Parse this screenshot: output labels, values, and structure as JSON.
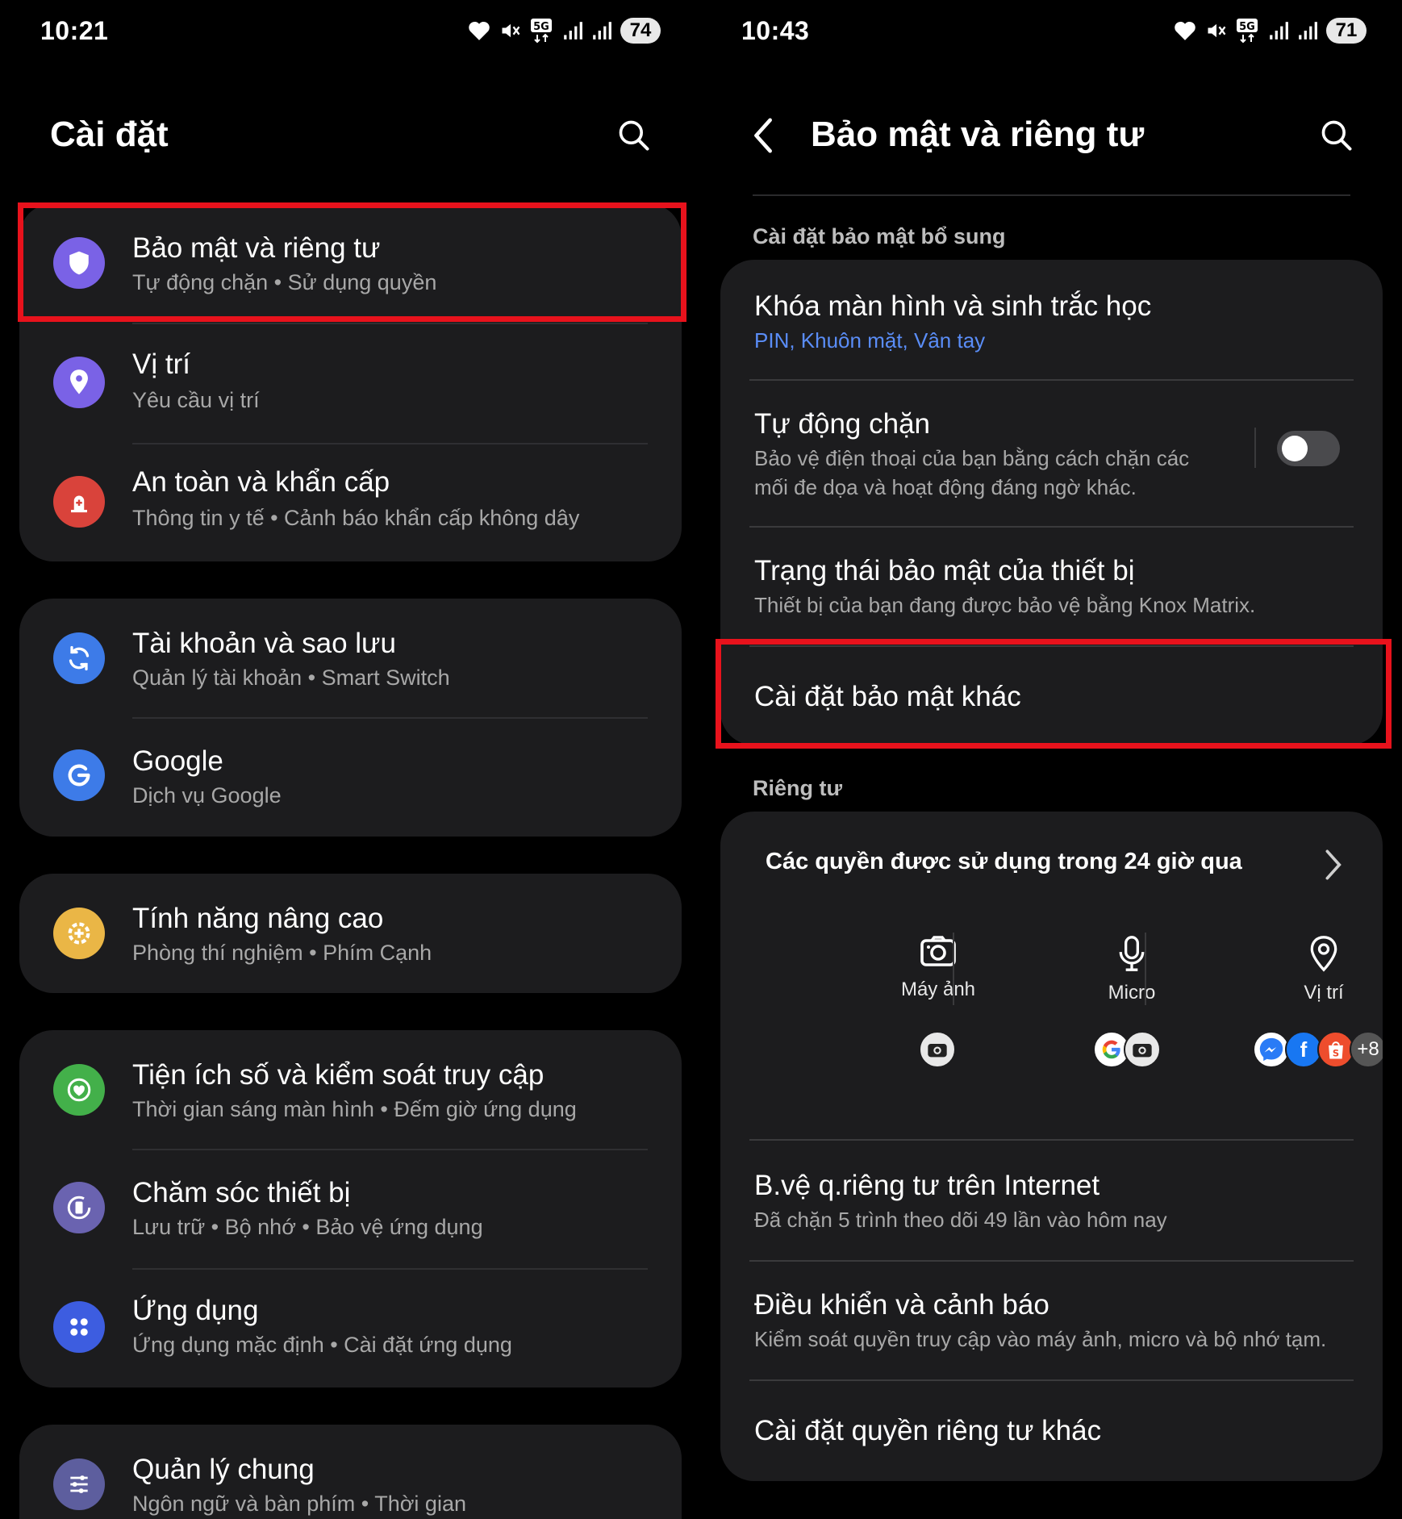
{
  "left": {
    "status": {
      "time": "10:21",
      "battery": "74"
    },
    "title": "Cài đặt",
    "groups": [
      {
        "items": [
          {
            "title": "Bảo mật và riêng tư",
            "subtitle": "Tự động chặn  •  Sử dụng quyền",
            "icon": "shield-icon",
            "color": "#7a62e6"
          },
          {
            "title": "Vị trí",
            "subtitle": "Yêu cầu vị trí",
            "icon": "location-pin-icon",
            "color": "#7a62e6"
          },
          {
            "title": "An toàn và khẩn cấp",
            "subtitle": "Thông tin y tế  •  Cảnh báo khẩn cấp không dây",
            "icon": "emergency-icon",
            "color": "#d9433b"
          }
        ]
      },
      {
        "items": [
          {
            "title": "Tài khoản và sao lưu",
            "subtitle": "Quản lý tài khoản  •  Smart Switch",
            "icon": "sync-icon",
            "color": "#3d7be8"
          },
          {
            "title": "Google",
            "subtitle": "Dịch vụ Google",
            "icon": "google-icon",
            "color": "#3d7be8"
          }
        ]
      },
      {
        "items": [
          {
            "title": "Tính năng nâng cao",
            "subtitle": "Phòng thí nghiệm  •  Phím Cạnh",
            "icon": "plus-gear-icon",
            "color": "#eab646"
          }
        ]
      },
      {
        "items": [
          {
            "title": "Tiện ích số và kiểm soát truy cập",
            "subtitle": "Thời gian sáng màn hình  •  Đếm giờ ứng dụng",
            "icon": "wellbeing-icon",
            "color": "#43b04a"
          },
          {
            "title": "Chăm sóc thiết bị",
            "subtitle": "Lưu trữ  •  Bộ nhớ  •  Bảo vệ ứng dụng",
            "icon": "device-care-icon",
            "color": "#6a63b0"
          },
          {
            "title": "Ứng dụng",
            "subtitle": "Ứng dụng mặc định  •  Cài đặt ứng dụng",
            "icon": "apps-grid-icon",
            "color": "#3d5de0"
          }
        ]
      },
      {
        "items": [
          {
            "title": "Quản lý chung",
            "subtitle": "Ngôn ngữ và bàn phím  •  Thời gian",
            "icon": "sliders-icon",
            "color": "#5d5e9e"
          }
        ]
      }
    ]
  },
  "right": {
    "status": {
      "time": "10:43",
      "battery": "71"
    },
    "title": "Bảo mật và riêng tư",
    "section_security": "Cài đặt bảo mật bổ sung",
    "lockscreen": {
      "title": "Khóa màn hình và sinh trắc học",
      "subtitle": "PIN, Khuôn mặt, Vân tay"
    },
    "autoblock": {
      "title": "Tự động chặn",
      "subtitle_l1": "Bảo vệ điện thoại của bạn bằng cách chặn các",
      "subtitle_l2": "mối đe dọa và hoạt động đáng ngờ khác.",
      "toggle_on": false
    },
    "device_status": {
      "title": "Trạng thái bảo mật của thiết bị",
      "subtitle": "Thiết bị của bạn đang được bảo vệ bằng Knox Matrix."
    },
    "other_security": {
      "title": "Cài đặt bảo mật khác"
    },
    "section_privacy": "Riêng tư",
    "permissions": {
      "title": "Các quyền được sử dụng trong 24 giờ qua",
      "columns": [
        {
          "label": "Máy ảnh",
          "icon": "camera-icon"
        },
        {
          "label": "Micro",
          "icon": "microphone-icon"
        },
        {
          "label": "Vị trí",
          "icon": "location-pin-icon"
        }
      ],
      "more_count": "+8"
    },
    "internet_privacy": {
      "title": "B.vệ q.riêng tư trên Internet",
      "subtitle": "Đã chặn 5 trình theo dõi 49 lần vào hôm nay"
    },
    "controls": {
      "title": "Điều khiển và cảnh báo",
      "subtitle": "Kiểm soát quyền truy cập vào máy ảnh, micro và bộ nhớ tạm."
    },
    "other_privacy": {
      "title": "Cài đặt quyền riêng tư khác"
    }
  },
  "colors": {
    "highlight": "#e8121c",
    "link_blue": "#5a8df7",
    "card_bg": "#1c1c1e"
  }
}
